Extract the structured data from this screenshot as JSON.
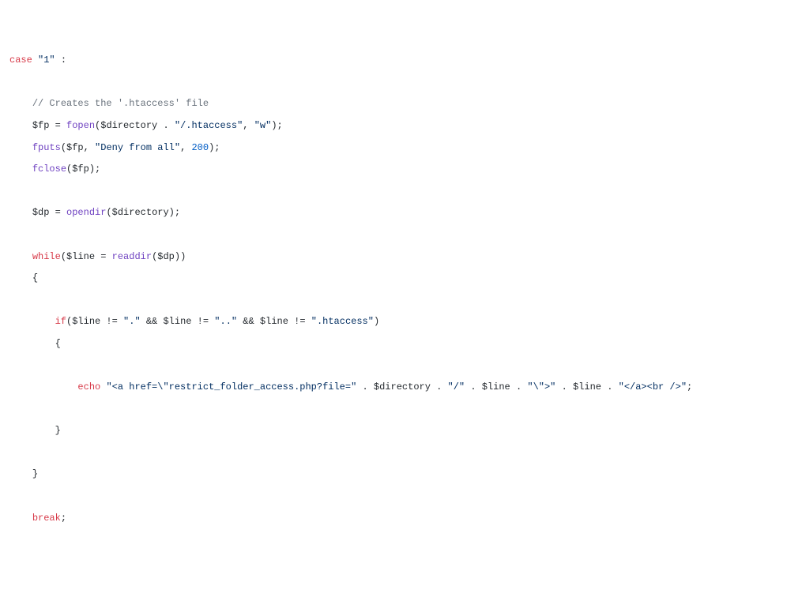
{
  "line1_case": "case",
  "line1_str": "\"1\"",
  "line1_rest": " :",
  "line2_cmt": "// Creates the '.htaccess' file",
  "line3_var": "$fp",
  "line3_eq": " = ",
  "line3_fn": "fopen",
  "line3_p1": "(",
  "line3_dir": "$directory",
  "line3_dot": " . ",
  "line3_str1": "\"/.htaccess\"",
  "line3_com": ", ",
  "line3_str2": "\"w\"",
  "line3_end": ");",
  "line4_fn": "fputs",
  "line4_p1": "(",
  "line4_var": "$fp",
  "line4_c1": ", ",
  "line4_str": "\"Deny from all\"",
  "line4_c2": ", ",
  "line4_num": "200",
  "line4_end": ");",
  "line5_fn": "fclose",
  "line5_p1": "(",
  "line5_var": "$fp",
  "line5_end": ");",
  "line6_var": "$dp",
  "line6_eq": " = ",
  "line6_fn": "opendir",
  "line6_p1": "(",
  "line6_dir": "$directory",
  "line6_end": ");",
  "line7_kw": "while",
  "line7_p1": "(",
  "line7_var": "$line",
  "line7_eq": " = ",
  "line7_fn": "readdir",
  "line7_p2": "(",
  "line7_dp": "$dp",
  "line7_end": "))",
  "line8_brace": "{",
  "line9_kw": "if",
  "line9_p1": "(",
  "line9_v1": "$line",
  "line9_ne1": " != ",
  "line9_s1": "\".\"",
  "line9_and1": " && ",
  "line9_v2": "$line",
  "line9_ne2": " != ",
  "line9_s2": "\"..\"",
  "line9_and2": " && ",
  "line9_v3": "$line",
  "line9_ne3": " != ",
  "line9_s3": "\".htaccess\"",
  "line9_end": ")",
  "line10_brace": "{",
  "line11_kw": "echo",
  "line11_sp": " ",
  "line11_s1": "\"<a href=\\\"restrict_folder_access.php?file=\"",
  "line11_d1": " . ",
  "line11_v1": "$directory",
  "line11_d2": " . ",
  "line11_s2": "\"/\"",
  "line11_d3": " . ",
  "line11_v2": "$line",
  "line11_d4": " . ",
  "line11_s3": "\"\\\">\"",
  "line11_d5": " . ",
  "line11_v3": "$line",
  "line11_d6": " . ",
  "line11_s4": "\"</a><br />\"",
  "line11_end": ";",
  "line12_brace": "}",
  "line13_brace": "}",
  "line14_kw": "break",
  "line14_end": ";"
}
